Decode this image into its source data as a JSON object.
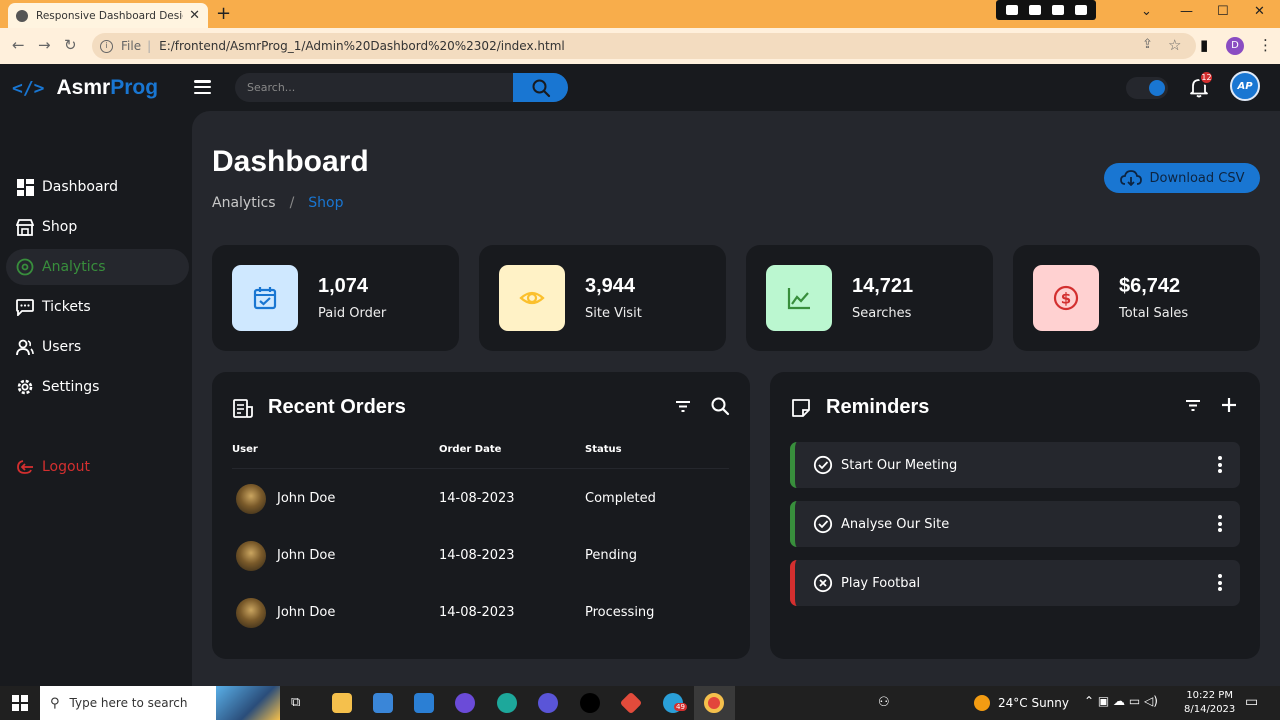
{
  "browser": {
    "tab_title": "Responsive Dashboard Design #",
    "url_scheme": "File",
    "url": "E:/frontend/AsmrProg_1/Admin%20Dashbord%20%2302/index.html",
    "profile_initial": "D"
  },
  "app": {
    "logo": {
      "part1": "Asmr",
      "part2": "Prog"
    },
    "search_placeholder": "Search...",
    "notification_count": "12",
    "avatar_initials": "AP"
  },
  "sidebar": {
    "items": [
      {
        "label": "Dashboard",
        "icon": "dashboard-icon"
      },
      {
        "label": "Shop",
        "icon": "store-icon"
      },
      {
        "label": "Analytics",
        "icon": "analytics-icon",
        "active": true
      },
      {
        "label": "Tickets",
        "icon": "message-icon"
      },
      {
        "label": "Users",
        "icon": "users-icon"
      },
      {
        "label": "Settings",
        "icon": "settings-icon"
      }
    ],
    "logout": "Logout"
  },
  "header": {
    "title": "Dashboard",
    "breadcrumb": [
      "Analytics",
      "/",
      "Shop"
    ],
    "download_label": "Download CSV"
  },
  "stats": [
    {
      "value": "1,074",
      "label": "Paid Order",
      "icon": "calendar-check-icon",
      "color": "#cfe8ff",
      "icon_color": "#1976d2"
    },
    {
      "value": "3,944",
      "label": "Site Visit",
      "icon": "eye-icon",
      "color": "#fff2c6",
      "icon_color": "#fbc02d"
    },
    {
      "value": "14,721",
      "label": "Searches",
      "icon": "line-chart-icon",
      "color": "#bbf7d0",
      "icon_color": "#388e3c"
    },
    {
      "value": "$6,742",
      "label": "Total Sales",
      "icon": "dollar-circle-icon",
      "color": "#ffd1d1",
      "icon_color": "#d32f2f"
    }
  ],
  "orders": {
    "title": "Recent Orders",
    "columns": [
      "User",
      "Order Date",
      "Status"
    ],
    "rows": [
      {
        "user": "John Doe",
        "date": "14-08-2023",
        "status": "Completed"
      },
      {
        "user": "John Doe",
        "date": "14-08-2023",
        "status": "Pending"
      },
      {
        "user": "John Doe",
        "date": "14-08-2023",
        "status": "Processing"
      }
    ]
  },
  "reminders": {
    "title": "Reminders",
    "items": [
      {
        "label": "Start Our Meeting",
        "state": "completed"
      },
      {
        "label": "Analyse Our Site",
        "state": "completed"
      },
      {
        "label": "Play Footbal",
        "state": "not-completed"
      }
    ]
  },
  "taskbar": {
    "search_placeholder": "Type here to search",
    "weather": "24°C  Sunny",
    "time": "10:22 PM",
    "date": "8/14/2023",
    "badge": "49"
  },
  "colors": {
    "primary": "#1976d2",
    "success": "#388e3c",
    "danger": "#d32f2f",
    "dark": "#181a1e",
    "light_dark": "#25272d"
  }
}
